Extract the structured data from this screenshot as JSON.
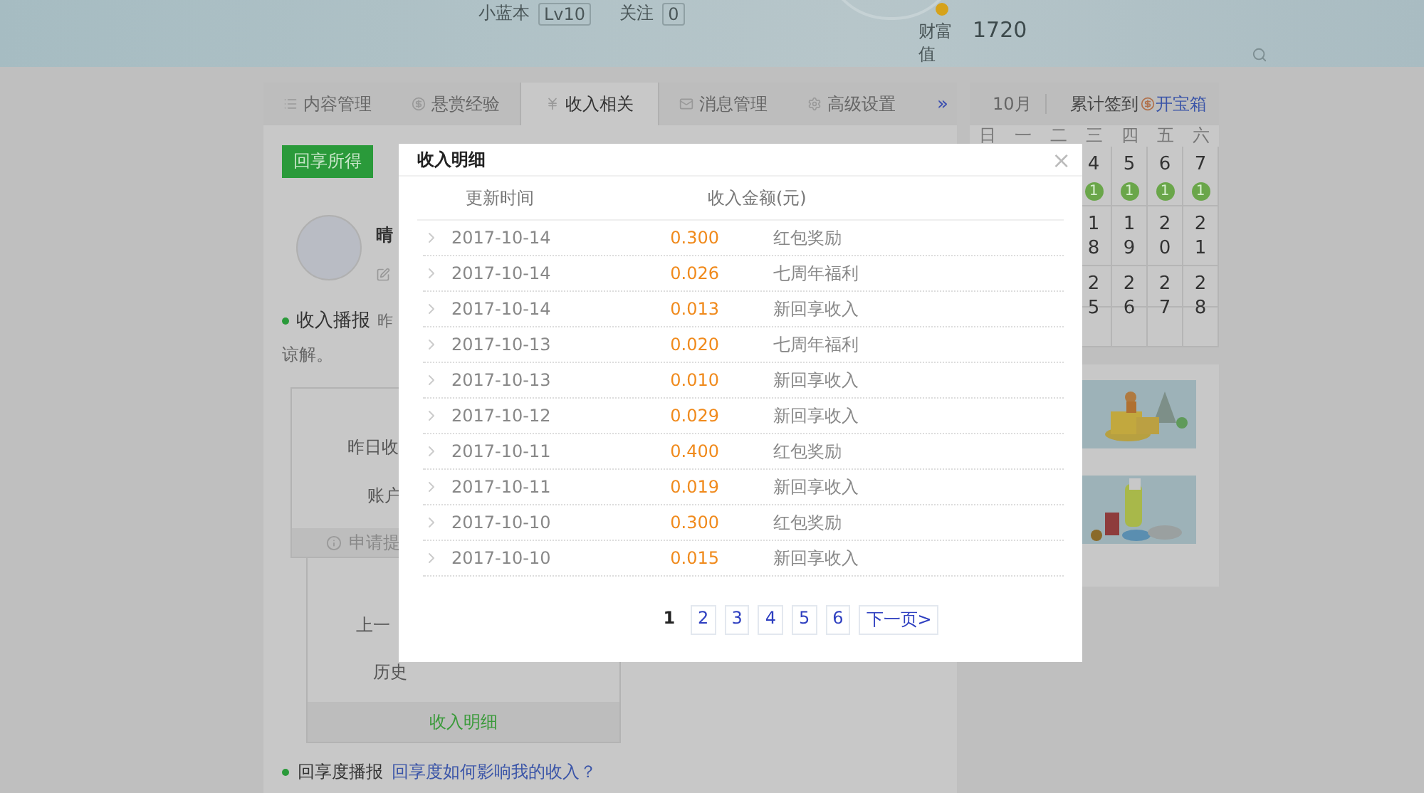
{
  "header": {
    "level_label": "小蓝本",
    "level": "Lv10",
    "follow_label": "关注",
    "follow_count": "0",
    "wealth_label_lines": [
      "财富",
      "值"
    ],
    "wealth_value": "1720"
  },
  "tabs": [
    {
      "label": "内容管理",
      "selected": false
    },
    {
      "label": "悬赏经验",
      "selected": false
    },
    {
      "label": "收入相关",
      "selected": true
    },
    {
      "label": "消息管理",
      "selected": false
    },
    {
      "label": "高级设置",
      "selected": false
    }
  ],
  "tabs_more": "»",
  "left": {
    "action_button": "回享所得",
    "user_name": "晴",
    "income_report": {
      "title": "收入播报",
      "text": "昨"
    },
    "report_line2": "谅解。",
    "summary_box": {
      "lines": [
        "昨日收",
        "账户"
      ],
      "footer": "申请提"
    },
    "history_box": {
      "lines": [
        "上一",
        "历史"
      ],
      "footer_link": "收入明细"
    },
    "score_report": {
      "title": "回享度播报",
      "link": "回享度如何影响我的收入？"
    }
  },
  "calendar": {
    "month": "10月",
    "total_label": "累计签到",
    "chest_link": "开宝箱",
    "weekdays": [
      "日",
      "一",
      "二",
      "三",
      "四",
      "五",
      "六"
    ],
    "weeks": [
      [
        {
          "day": "4",
          "badge": "1"
        },
        {
          "day": "5",
          "badge": "1"
        },
        {
          "day": "6",
          "badge": "1"
        },
        {
          "day": "7",
          "badge": "1"
        }
      ],
      [
        {
          "day": "18"
        },
        {
          "day": "19"
        },
        {
          "day": "20"
        },
        {
          "day": "21"
        }
      ],
      [
        {
          "day": "25"
        },
        {
          "day": "26"
        },
        {
          "day": "27"
        },
        {
          "day": "28"
        }
      ]
    ]
  },
  "modal": {
    "title": "收入明细",
    "close": "×",
    "columns": [
      "更新时间",
      "收入金额(元)"
    ],
    "rows": [
      {
        "date": "2017-10-14",
        "amount": "0.300",
        "type": "红包奖励"
      },
      {
        "date": "2017-10-14",
        "amount": "0.026",
        "type": "七周年福利"
      },
      {
        "date": "2017-10-14",
        "amount": "0.013",
        "type": "新回享收入"
      },
      {
        "date": "2017-10-13",
        "amount": "0.020",
        "type": "七周年福利"
      },
      {
        "date": "2017-10-13",
        "amount": "0.010",
        "type": "新回享收入"
      },
      {
        "date": "2017-10-12",
        "amount": "0.029",
        "type": "新回享收入"
      },
      {
        "date": "2017-10-11",
        "amount": "0.400",
        "type": "红包奖励"
      },
      {
        "date": "2017-10-11",
        "amount": "0.019",
        "type": "新回享收入"
      },
      {
        "date": "2017-10-10",
        "amount": "0.300",
        "type": "红包奖励"
      },
      {
        "date": "2017-10-10",
        "amount": "0.015",
        "type": "新回享收入"
      }
    ],
    "pages": [
      {
        "label": "1",
        "selected": true
      },
      {
        "label": "2",
        "selected": false
      },
      {
        "label": "3",
        "selected": false
      },
      {
        "label": "4",
        "selected": false
      },
      {
        "label": "5",
        "selected": false
      },
      {
        "label": "6",
        "selected": false
      }
    ],
    "next": "下一页>"
  }
}
